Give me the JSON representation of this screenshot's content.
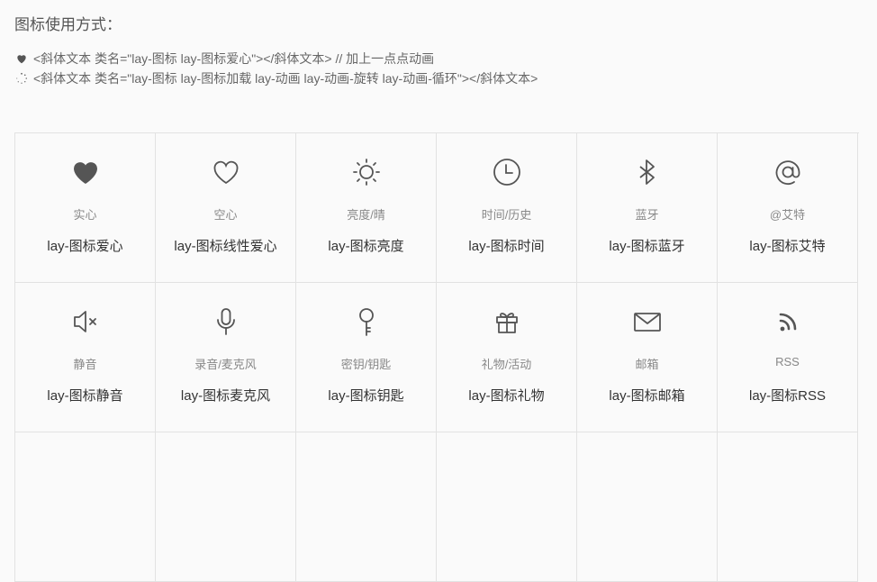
{
  "title": "图标使用方式：",
  "code_lines": [
    {
      "icon": "heart-filled-icon",
      "text": "<斜体文本 类名=\"lay-图标 lay-图标爱心\"></斜体文本> // 加上一点点动画"
    },
    {
      "icon": "loading-icon",
      "text": "<斜体文本 类名=\"lay-图标 lay-图标加载 lay-动画 lay-动画-旋转 lay-动画-循环\"></斜体文本>"
    }
  ],
  "icons": [
    {
      "icon": "heart-filled-icon",
      "desc": "实心",
      "cls": "lay-图标爱心"
    },
    {
      "icon": "heart-outline-icon",
      "desc": "空心",
      "cls": "lay-图标线性爱心"
    },
    {
      "icon": "sun-icon",
      "desc": "亮度/晴",
      "cls": "lay-图标亮度"
    },
    {
      "icon": "clock-icon",
      "desc": "时间/历史",
      "cls": "lay-图标时间"
    },
    {
      "icon": "bluetooth-icon",
      "desc": "蓝牙",
      "cls": "lay-图标蓝牙"
    },
    {
      "icon": "at-icon",
      "desc": "@艾特",
      "cls": "lay-图标艾特"
    },
    {
      "icon": "mute-icon",
      "desc": "静音",
      "cls": "lay-图标静音"
    },
    {
      "icon": "microphone-icon",
      "desc": "录音/麦克风",
      "cls": "lay-图标麦克风"
    },
    {
      "icon": "key-icon",
      "desc": "密钥/钥匙",
      "cls": "lay-图标钥匙"
    },
    {
      "icon": "gift-icon",
      "desc": "礼物/活动",
      "cls": "lay-图标礼物"
    },
    {
      "icon": "mail-icon",
      "desc": "邮箱",
      "cls": "lay-图标邮箱"
    },
    {
      "icon": "rss-icon",
      "desc": "RSS",
      "cls": "lay-图标RSS"
    },
    {
      "icon": "",
      "desc": "",
      "cls": ""
    },
    {
      "icon": "",
      "desc": "",
      "cls": ""
    },
    {
      "icon": "",
      "desc": "",
      "cls": ""
    },
    {
      "icon": "",
      "desc": "",
      "cls": ""
    },
    {
      "icon": "",
      "desc": "",
      "cls": ""
    },
    {
      "icon": "",
      "desc": "",
      "cls": ""
    }
  ],
  "colors": {
    "icon": "#555555",
    "border": "#e2e2e2",
    "background": "#fafafa"
  }
}
